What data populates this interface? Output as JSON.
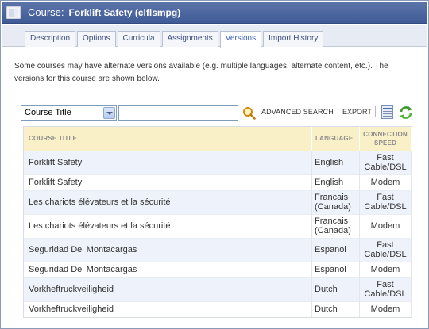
{
  "header": {
    "type_label": "Course:",
    "course_name": "Forklift Safety (clflsmpg)"
  },
  "tabs": [
    {
      "label": "Description",
      "active": false
    },
    {
      "label": "Options",
      "active": false
    },
    {
      "label": "Curricula",
      "active": false
    },
    {
      "label": "Assignments",
      "active": false
    },
    {
      "label": "Versions",
      "active": true
    },
    {
      "label": "Import History",
      "active": false
    }
  ],
  "intro": {
    "line1": "Some courses may have alternate versions available (e.g. multiple languages, alternate content, etc.). The",
    "line2": "versions for this course are shown below."
  },
  "toolbar": {
    "filter_selected": "Course Title",
    "search_value": "",
    "advanced_search": "ADVANCED SEARCH",
    "export": "EXPORT"
  },
  "table": {
    "headers": {
      "title": "COURSE TITLE",
      "language": "LANGUAGE",
      "speed_line1": "CONNECTION",
      "speed_line2": "SPEED"
    },
    "rows": [
      {
        "title": "Forklift Safety",
        "lang1": "English",
        "lang2": "",
        "speed1": "Fast",
        "speed2": "Cable/DSL"
      },
      {
        "title": "Forklift Safety",
        "lang1": "English",
        "lang2": "",
        "speed1": "Modem",
        "speed2": ""
      },
      {
        "title": "Les chariots élévateurs et la sécurité",
        "lang1": "Francais",
        "lang2": "(Canada)",
        "speed1": "Fast",
        "speed2": "Cable/DSL"
      },
      {
        "title": "Les chariots élévateurs et la sécurité",
        "lang1": "Francais",
        "lang2": "(Canada)",
        "speed1": "Modem",
        "speed2": ""
      },
      {
        "title": "Seguridad Del Montacargas",
        "lang1": "Espanol",
        "lang2": "",
        "speed1": "Fast",
        "speed2": "Cable/DSL"
      },
      {
        "title": "Seguridad Del Montacargas",
        "lang1": "Espanol",
        "lang2": "",
        "speed1": "Modem",
        "speed2": ""
      },
      {
        "title": "Vorkheftruckveiligheid",
        "lang1": "Dutch",
        "lang2": "",
        "speed1": "Fast",
        "speed2": "Cable/DSL"
      },
      {
        "title": "Vorkheftruckveiligheid",
        "lang1": "Dutch",
        "lang2": "",
        "speed1": "Modem",
        "speed2": ""
      }
    ]
  }
}
